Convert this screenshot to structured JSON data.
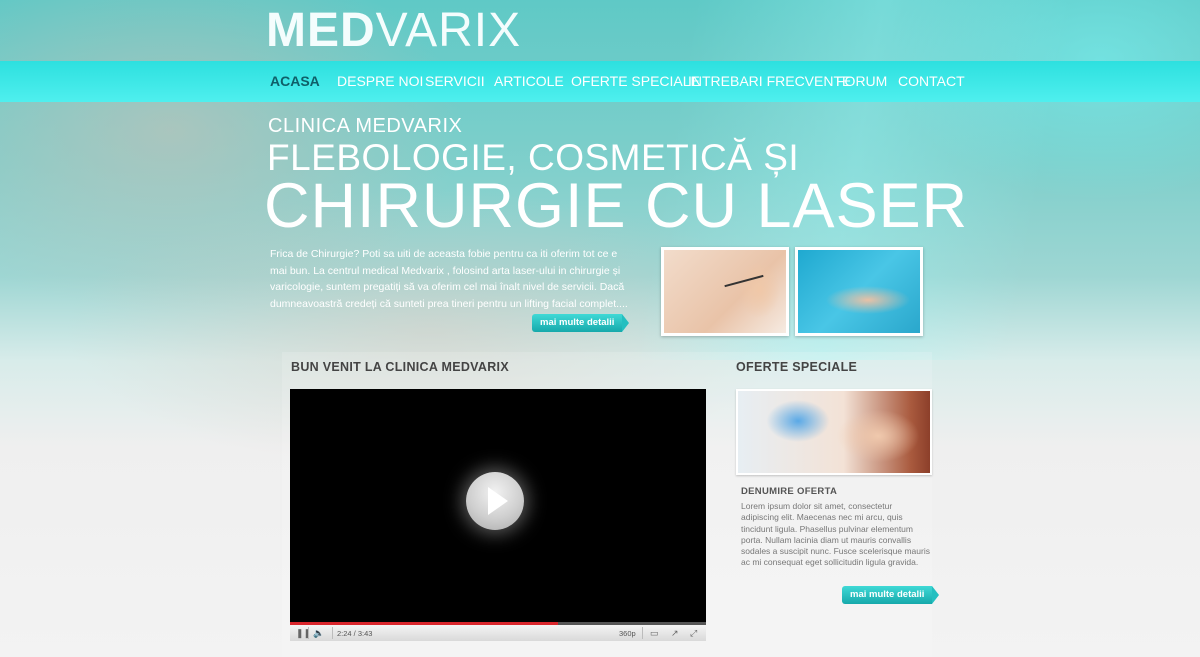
{
  "brand": {
    "logo_bold": "MED",
    "logo_thin": "VARIX"
  },
  "nav": {
    "items": [
      {
        "label": "ACASA",
        "active": true
      },
      {
        "label": "DESPRE NOI",
        "active": false
      },
      {
        "label": "SERVICII",
        "active": false
      },
      {
        "label": "ARTICOLE",
        "active": false
      },
      {
        "label": "OFERTE SPECIALE",
        "active": false
      },
      {
        "label": "INTREBARI FRECVENTE",
        "active": false
      },
      {
        "label": "FORUM",
        "active": false
      },
      {
        "label": "CONTACT",
        "active": false
      }
    ]
  },
  "hero": {
    "subtitle": "CLINICA MEDVARIX",
    "line2": "FLEBOLOGIE, COSMETICĂ ȘI",
    "line3": "CHIRURGIE CU LASER",
    "intro": "Frica de Chirurgie? Poti sa uiti de aceasta fobie pentru ca iti oferim tot ce e mai bun. La centrul medical Medvarix , folosind arta laser-ului in chirurgie și varicologie, suntem pregatiți să va oferim cel mai înalt nivel de servicii. Dacă dumneavoastră credeți că sunteti prea tineri pentru un lifting facial complet....",
    "more_label": "mai multe detalii"
  },
  "welcome": {
    "title": "BUN VENIT LA CLINICA MEDVARIX",
    "video": {
      "time": "2:24 / 3:43",
      "quality": "360p",
      "progress": 0.645
    }
  },
  "offers": {
    "title": "OFERTE SPECIALE",
    "name": "DENUMIRE OFERTA",
    "description": "Lorem ipsum dolor sit amet, consectetur adipiscing elit. Maecenas nec mi arcu, quis tincidunt ligula. Phasellus pulvinar elementum porta. Nullam lacinia diam ut mauris convallis sodales a suscipit nunc. Fusce scelerisque mauris ac mi consequat eget sollicitudin ligula gravida.",
    "more_label": "mai multe detalii"
  },
  "colors": {
    "nav_bar": "#2de0df",
    "nav_active": "#0f5f68",
    "button": "#16a9ab",
    "video_progress": "#d9262c"
  }
}
